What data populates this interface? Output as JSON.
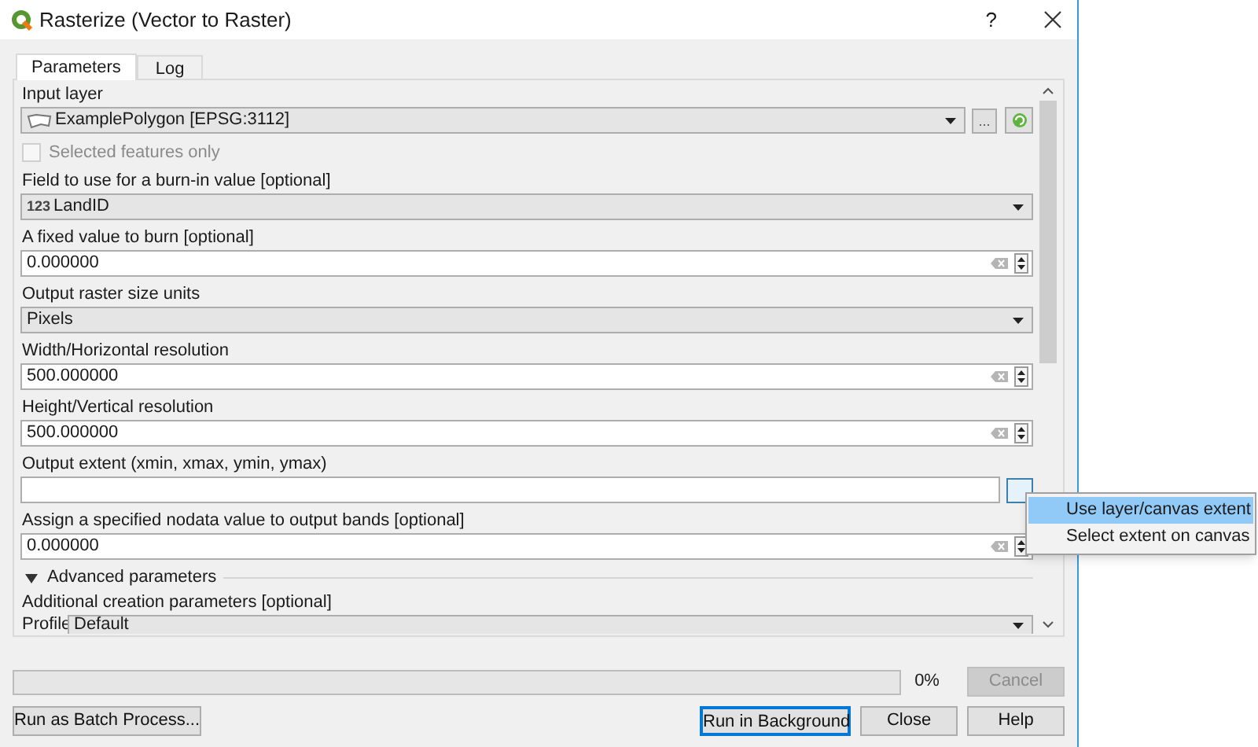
{
  "window": {
    "title": "Rasterize (Vector to Raster)",
    "help": "?"
  },
  "tabs": [
    {
      "label": "Parameters",
      "selected": true
    },
    {
      "label": "Log",
      "selected": false
    }
  ],
  "parameters": [
    {
      "kind": "layer",
      "label": "Input layer",
      "value": "ExamplePolygon [EPSG:3112]",
      "browse": "..."
    },
    {
      "kind": "checkbox",
      "label": "Selected features only",
      "checked": false,
      "disabled": true
    },
    {
      "kind": "combo",
      "label": "Field to use for a burn-in value [optional]",
      "prefix": "123",
      "value": "LandID"
    },
    {
      "kind": "number",
      "label": "A fixed value to burn [optional]",
      "value": "0.000000"
    },
    {
      "kind": "combo",
      "label": "Output raster size units",
      "value": "Pixels"
    },
    {
      "kind": "number",
      "label": "Width/Horizontal resolution",
      "value": "500.000000"
    },
    {
      "kind": "number",
      "label": "Height/Vertical resolution",
      "value": "500.000000"
    },
    {
      "kind": "extent",
      "label": "Output extent (xmin, xmax, ymin, ymax)"
    },
    {
      "kind": "number",
      "label": "Assign a specified nodata value to output bands [optional]",
      "value": "0.000000"
    },
    {
      "kind": "section",
      "label": "Advanced parameters",
      "expanded": true
    },
    {
      "kind": "heading",
      "label": "Additional creation parameters [optional]"
    },
    {
      "kind": "profile",
      "label": "Profile",
      "value": "Default"
    }
  ],
  "progress": {
    "level": 0,
    "reading": "0%"
  },
  "buttons": [
    {
      "label": "Cancel",
      "disabled": true,
      "focused": false
    },
    {
      "label": "Run as Batch Process...",
      "disabled": false,
      "focused": false
    },
    {
      "label": "Run in Background",
      "disabled": false,
      "focused": true
    },
    {
      "label": "Close",
      "disabled": false,
      "focused": false
    },
    {
      "label": "Help",
      "disabled": false,
      "focused": false
    }
  ],
  "menu": [
    {
      "label": "Use layer/canvas extent",
      "selected": true
    },
    {
      "label": "Select extent on canvas",
      "selected": false
    }
  ]
}
